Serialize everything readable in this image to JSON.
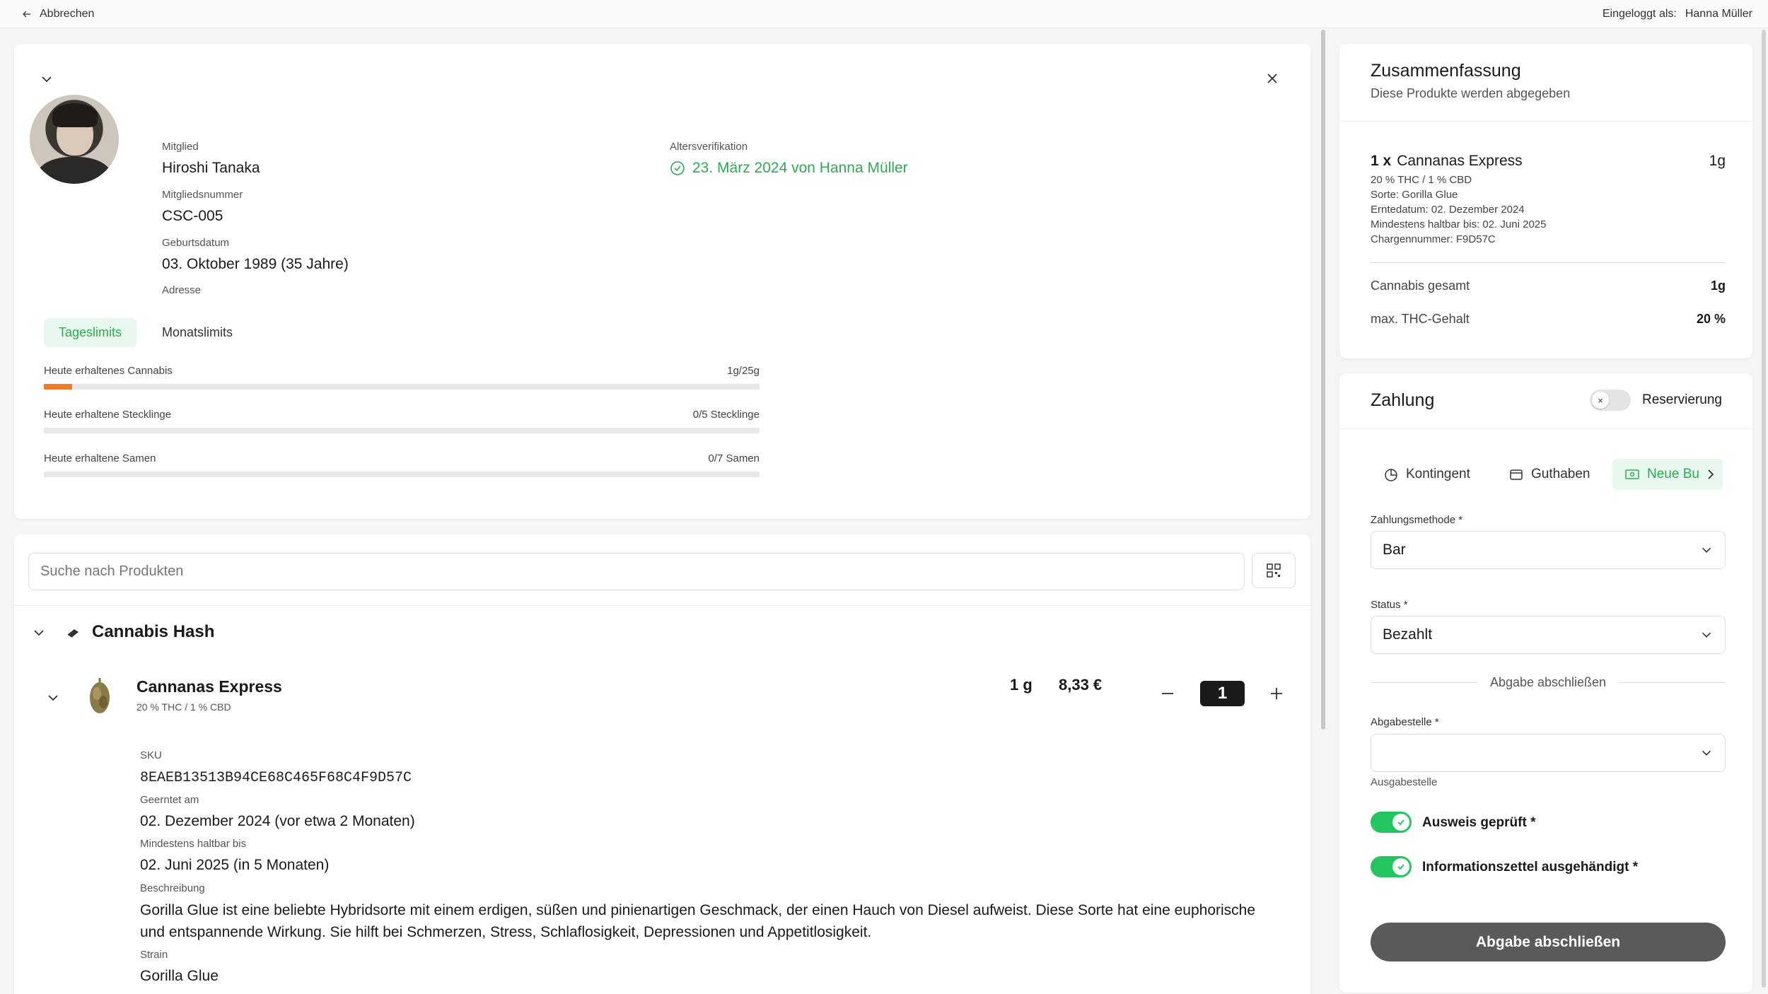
{
  "topbar": {
    "back_label": "Abbrechen",
    "logged_in_label": "Eingeloggt als:",
    "user_name": "Hanna Müller"
  },
  "member": {
    "member_label": "Mitglied",
    "member_name": "Hiroshi Tanaka",
    "number_label": "Mitgliedsnummer",
    "number": "CSC-005",
    "birth_label": "Geburtsdatum",
    "birth": "03. Oktober 1989 (35 Jahre)",
    "address_label": "Adresse",
    "age_label": "Altersverifikation",
    "age_verified": "23. März 2024 von Hanna Müller"
  },
  "limits": {
    "tabs": [
      "Tageslimits",
      "Monatslimits"
    ],
    "rows": [
      {
        "label": "Heute erhaltenes Cannabis",
        "value": "1g/25g",
        "progress": 0.04
      },
      {
        "label": "Heute erhaltene Stecklinge",
        "value": "0/5 Stecklinge",
        "progress": 0
      },
      {
        "label": "Heute erhaltene Samen",
        "value": "0/7 Samen",
        "progress": 0
      }
    ]
  },
  "products": {
    "search_placeholder": "Suche nach Produkten",
    "category": "Cannabis Hash",
    "item": {
      "name": "Cannanas Express",
      "sub": "20 % THC / 1 % CBD",
      "weight": "1 g",
      "price": "8,33 €",
      "quantity": "1",
      "sku_label": "SKU",
      "sku": "8EAEB13513B94CE68C465F68C4F9D57C",
      "harvest_label": "Geerntet am",
      "harvest": "02. Dezember 2024 (vor etwa 2 Monaten)",
      "best_before_label": "Mindestens haltbar bis",
      "best_before": "02. Juni 2025 (in 5 Monaten)",
      "desc_label": "Beschreibung",
      "description": "Gorilla Glue ist eine beliebte Hybridsorte mit einem erdigen, süßen und pinienartigen Geschmack, der einen Hauch von Diesel aufweist. Diese Sorte hat eine euphorische und entspannende Wirkung. Sie hilft bei Schmerzen, Stress, Schlaflosigkeit, Depressionen und Appetitlosigkeit.",
      "strain_label": "Strain",
      "strain": "Gorilla Glue"
    }
  },
  "summary": {
    "title": "Zusammenfassung",
    "subtitle": "Diese Produkte werden abgegeben",
    "item_qty": "1 x",
    "item_name": "Cannanas Express",
    "item_amount": "1g",
    "item_meta": [
      "20 % THC / 1 % CBD",
      "Sorte: Gorilla Glue",
      "Erntedatum: 02. Dezember 2024",
      "Mindestens haltbar bis: 02. Juni 2025",
      "Chargennummer: F9D57C"
    ],
    "total_label": "Cannabis gesamt",
    "total_value": "1g",
    "thc_label": "max. THC-Gehalt",
    "thc_value": "20 %"
  },
  "payment": {
    "title": "Zahlung",
    "reservation_label": "Reservierung",
    "reservation_on": false,
    "tabs": [
      "Kontingent",
      "Guthaben",
      "Neue Bu"
    ],
    "method_label": "Zahlungsmethode *",
    "method_value": "Bar",
    "status_label": "Status *",
    "status_value": "Bezahlt",
    "complete_separator": "Abgabe abschließen",
    "point_label": "Abgabestelle *",
    "point_value": "",
    "point_hint": "Ausgabestelle",
    "id_checked_label": "Ausweis geprüft *",
    "id_checked": true,
    "info_given_label": "Informationszettel ausgehändigt *",
    "info_given": true,
    "submit_label": "Abgabe abschließen"
  },
  "colors": {
    "accent_green": "#2eaa52",
    "switch_green": "#22c55e",
    "progress_orange": "#f07a2a",
    "submit_gray": "#5a5a5a"
  }
}
